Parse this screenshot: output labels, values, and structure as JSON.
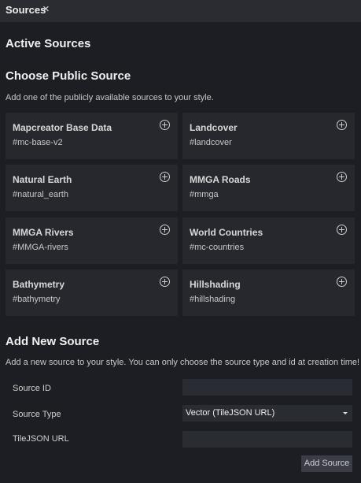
{
  "tab": {
    "title": "Sources",
    "close_glyph": "×"
  },
  "sections": {
    "active": {
      "title": "Active Sources"
    },
    "public": {
      "title": "Choose Public Source",
      "description": "Add one of the publicly available sources to your style.",
      "cards": [
        {
          "name": "Mapcreator Base Data",
          "id": "#mc-base-v2"
        },
        {
          "name": "Landcover",
          "id": "#landcover"
        },
        {
          "name": "Natural Earth",
          "id": "#natural_earth"
        },
        {
          "name": "MMGA Roads",
          "id": "#mmga"
        },
        {
          "name": "MMGA Rivers",
          "id": "#MMGA-rivers"
        },
        {
          "name": "World Countries",
          "id": "#mc-countries"
        },
        {
          "name": "Bathymetry",
          "id": "#bathymetry"
        },
        {
          "name": "Hillshading",
          "id": "#hillshading"
        }
      ]
    },
    "new": {
      "title": "Add New Source",
      "description": "Add a new source to your style. You can only choose the source type and id at creation time!",
      "fields": {
        "source_id_label": "Source ID",
        "source_id_value": "",
        "source_type_label": "Source Type",
        "source_type_value": "Vector (TileJSON URL)",
        "tilejson_label": "TileJSON URL",
        "tilejson_value": ""
      },
      "add_button": "Add Source"
    }
  },
  "icons": {
    "add": "plus-circle-icon",
    "caret": "chevron-down-icon",
    "close": "close-icon"
  }
}
